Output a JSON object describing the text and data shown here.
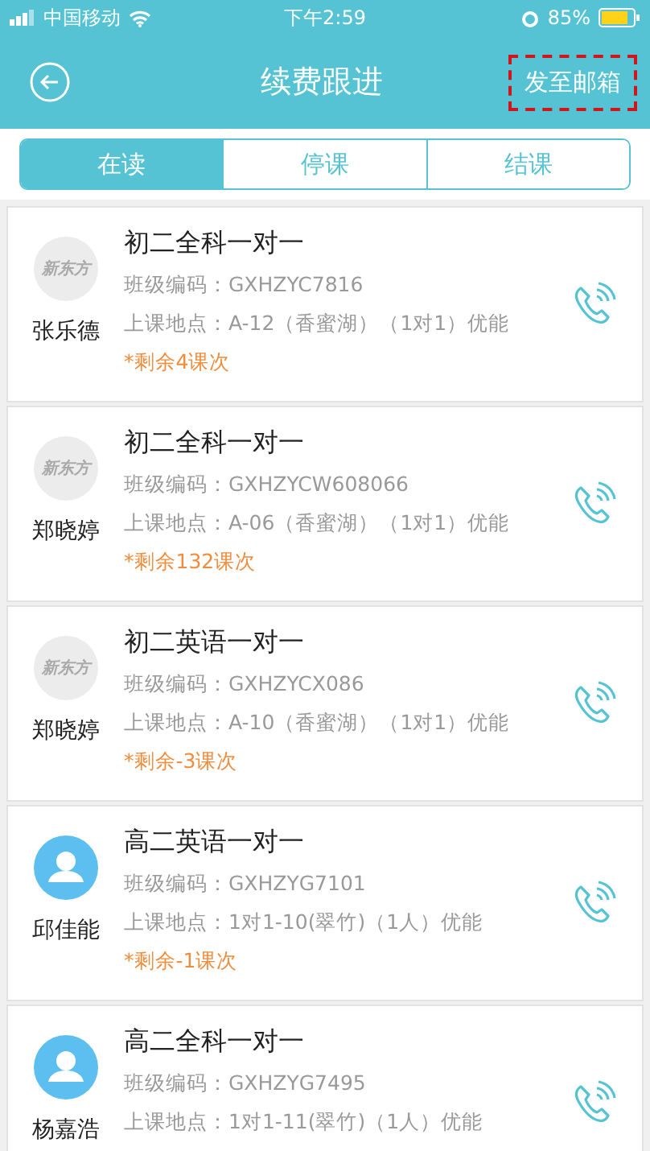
{
  "status_bar": {
    "carrier": "中国移动",
    "time": "下午2:59",
    "battery": "85%"
  },
  "header": {
    "title": "续费跟进",
    "action": {
      "label": "发至邮箱",
      "highlighted": true
    }
  },
  "tabs": [
    {
      "label": "在读",
      "selected": true
    },
    {
      "label": "停课",
      "selected": false
    },
    {
      "label": "结课",
      "selected": false
    }
  ],
  "students": [
    {
      "name": "张乐德",
      "avatar": {
        "kind": "logo",
        "text": "新东方"
      },
      "course": "初二全科一对一",
      "class_code": "班级编码：GXHZYC7816",
      "location": "上课地点：A-12（香蜜湖）（1对1）优能",
      "remaining": "*剩余4课次"
    },
    {
      "name": "郑晓婷",
      "avatar": {
        "kind": "logo",
        "text": "新东方"
      },
      "course": "初二全科一对一",
      "class_code": "班级编码：GXHZYCW608066",
      "location": "上课地点：A-06（香蜜湖）（1对1）优能",
      "remaining": "*剩余132课次"
    },
    {
      "name": "郑晓婷",
      "avatar": {
        "kind": "logo",
        "text": "新东方"
      },
      "course": "初二英语一对一",
      "class_code": "班级编码：GXHZYCX086",
      "location": "上课地点：A-10（香蜜湖）（1对1）优能",
      "remaining": "*剩余-3课次"
    },
    {
      "name": "邱佳能",
      "avatar": {
        "kind": "person"
      },
      "course": "高二英语一对一",
      "class_code": "班级编码：GXHZYG7101",
      "location": "上课地点：1对1-10(翠竹)（1人）优能",
      "remaining": "*剩余-1课次"
    },
    {
      "name": "杨嘉浩",
      "avatar": {
        "kind": "person"
      },
      "course": "高二全科一对一",
      "class_code": "班级编码：GXHZYG7495",
      "location": "上课地点：1对1-11(翠竹)（1人）优能"
    }
  ]
}
